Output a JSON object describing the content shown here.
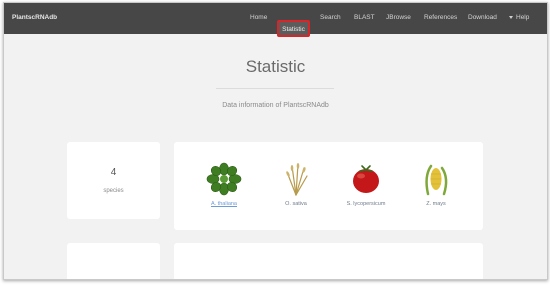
{
  "navbar": {
    "brand": "PlantscRNAdb",
    "items": [
      {
        "label": "Home"
      },
      {
        "label": "Statistic"
      },
      {
        "label": "Search"
      },
      {
        "label": "BLAST"
      },
      {
        "label": "JBrowse"
      },
      {
        "label": "References"
      },
      {
        "label": "Download"
      },
      {
        "label": "Help"
      }
    ],
    "active_index": 1,
    "highlight_color": "#d6262a"
  },
  "page": {
    "title": "Statistic",
    "subtitle": "Data information of PlantscRNAdb"
  },
  "species_count": {
    "number": "4",
    "label": "species"
  },
  "species": [
    {
      "name": "A. thaliana",
      "icon": "arabidopsis-rosette-icon",
      "is_link": true
    },
    {
      "name": "O. sativa",
      "icon": "rice-plant-icon",
      "is_link": false
    },
    {
      "name": "S. lycopersicum",
      "icon": "tomato-icon",
      "is_link": false
    },
    {
      "name": "Z. mays",
      "icon": "maize-icon",
      "is_link": false
    }
  ]
}
